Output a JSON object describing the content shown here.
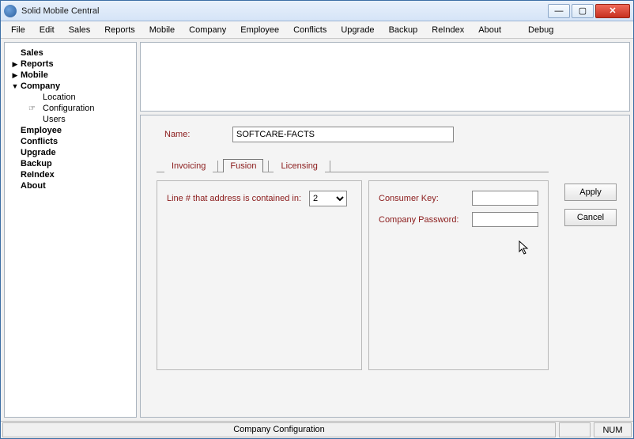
{
  "title": "Solid Mobile Central",
  "menus": [
    "File",
    "Edit",
    "Sales",
    "Reports",
    "Mobile",
    "Company",
    "Employee",
    "Conflicts",
    "Upgrade",
    "Backup",
    "ReIndex",
    "About",
    "Debug"
  ],
  "tree": {
    "sales": "Sales",
    "reports": "Reports",
    "mobile": "Mobile",
    "company": "Company",
    "company_children": {
      "location": "Location",
      "configuration": "Configuration",
      "users": "Users"
    },
    "employee": "Employee",
    "conflicts": "Conflicts",
    "upgrade": "Upgrade",
    "backup": "Backup",
    "reindex": "ReIndex",
    "about": "About"
  },
  "form": {
    "name_label": "Name:",
    "name_value": "SOFTCARE-FACTS",
    "tabs": {
      "invoicing": "Invoicing",
      "fusion": "Fusion",
      "licensing": "Licensing"
    },
    "line_label": "Line # that address is contained in:",
    "line_value": "2",
    "consumer_key_label": "Consumer Key:",
    "consumer_key_value": "",
    "company_password_label": "Company Password:",
    "company_password_value": "",
    "apply": "Apply",
    "cancel": "Cancel"
  },
  "status": {
    "text": "Company Configuration",
    "num": "NUM"
  }
}
